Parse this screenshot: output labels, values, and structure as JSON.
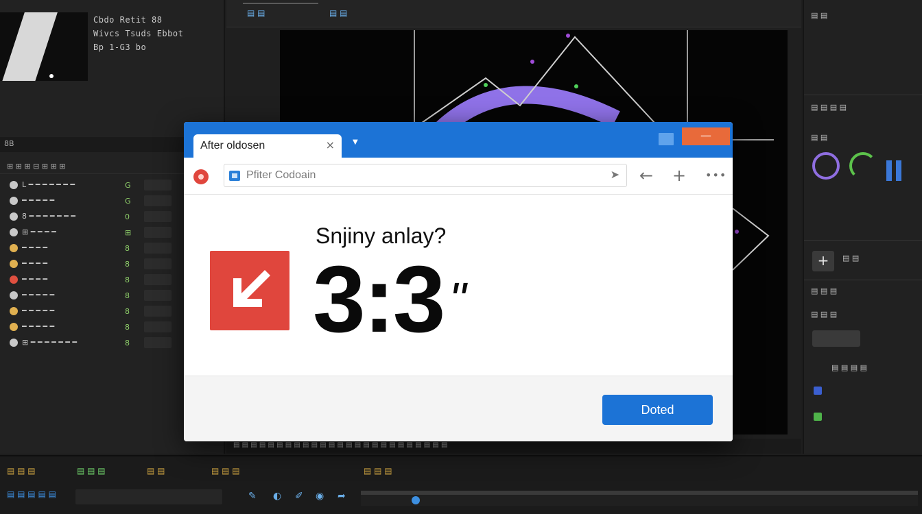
{
  "project": {
    "meta": [
      "Cbdo Retit 88",
      "Wivcs Tsuds Ebbot",
      "Bp 1-G3 bo"
    ],
    "footer": "8B",
    "layer_header": "⊞ ⊞          ⊞ ⊟          ⊞ ⊞ ⊞",
    "layers": [
      {
        "name": "L ━ ━ ━ ━ ━ ━ ━",
        "switch": "G",
        "icon_color": "#c8c8c8"
      },
      {
        "name": "━ ━ ━ ━ ━",
        "switch": "G",
        "icon_color": "#c8c8c8"
      },
      {
        "name": "8 ━ ━ ━ ━ ━ ━ ━",
        "switch": "0",
        "icon_color": "#c8c8c8"
      },
      {
        "name": "⊞ ━ ━ ━ ━",
        "switch": "⊞",
        "icon_color": "#c8c8c8"
      },
      {
        "name": "━ ━ ━ ━",
        "switch": "8",
        "icon_color": "#e0b050"
      },
      {
        "name": "━ ━ ━ ━",
        "switch": "8",
        "icon_color": "#e0b050"
      },
      {
        "name": "━ ━ ━ ━",
        "switch": "8",
        "icon_color": "#e05040"
      },
      {
        "name": "━ ━ ━ ━ ━",
        "switch": "8",
        "icon_color": "#c8c8c8"
      },
      {
        "name": "━ ━ ━ ━ ━",
        "switch": "8",
        "icon_color": "#e0b050"
      },
      {
        "name": "━ ━ ━ ━ ━",
        "switch": "8",
        "icon_color": "#e0b050"
      },
      {
        "name": "⊞ ━ ━ ━ ━ ━ ━ ━",
        "switch": "8",
        "icon_color": "#c8c8c8"
      }
    ]
  },
  "composition": {
    "tabs": [
      "▤ ▤",
      "▤ ▤"
    ],
    "bottom_bar": "▤ ▤ ▤ ▤ ▤ ▤ ▤ ▤ ▤ ▤ ▤ ▤ ▤ ▤ ▤ ▤ ▤ ▤ ▤ ▤ ▤ ▤ ▤ ▤ ▤",
    "colors": {
      "ring": "#8f72e8",
      "lines": "#cfcfcf",
      "dot_green": "#4fd05a",
      "dot_purple": "#a04cd8"
    }
  },
  "effects": {
    "sections": [
      "▤ ▤",
      "▤ ▤ ▤ ▤",
      "▤ ▤",
      "▤ ▤",
      "▤ ▤ ▤",
      "▤ ▤ ▤",
      "▤ ▤ ▤ ▤"
    ],
    "colors": {
      "dial_purple": "#8f6ee0",
      "dial_green": "#5cc24b",
      "bar_blue": "#3b78d8"
    }
  },
  "timeline": {
    "tabs": [
      "▤ ▤ ▤",
      "▤ ▤ ▤",
      "▤ ▤",
      "▤ ▤ ▤",
      "▤ ▤ ▤"
    ],
    "time": "▤ ▤ ▤ ▤ ▤"
  },
  "dialog": {
    "tab_title": "After oldosen",
    "tab_close": "×",
    "tab_dropdown": "▼",
    "window_close": "—",
    "address_placeholder": "Pfiter Codoain",
    "address_go": "➤",
    "back_icon": "←",
    "new_icon": "+",
    "more_icon": "•••",
    "question": "Snjiny anlay?",
    "value": "3:3",
    "value_mark": "\"",
    "button_label": "Doted",
    "colors": {
      "accent": "#1c73d6",
      "alert": "#e0463d",
      "close": "#e86a3a"
    },
    "status_icon": "arrow-down-left-icon"
  }
}
